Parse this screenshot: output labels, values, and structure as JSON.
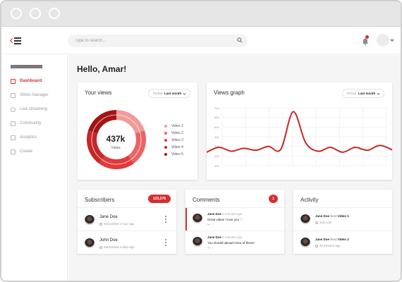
{
  "topbar": {
    "search_placeholder": "Type to search..."
  },
  "sidebar": {
    "items": [
      {
        "label": "Dashboard",
        "icon": "dashboard-icon",
        "active": true
      },
      {
        "label": "Video manager",
        "icon": "video-manager-icon"
      },
      {
        "label": "Live streaming",
        "icon": "live-streaming-icon"
      },
      {
        "label": "Community",
        "icon": "community-icon"
      },
      {
        "label": "Analytics",
        "icon": "analytics-icon"
      },
      {
        "label": "Create",
        "icon": "create-icon"
      }
    ]
  },
  "main": {
    "greeting": "Hello, Amar!"
  },
  "views_card": {
    "title": "Your views",
    "period_label": "Period",
    "period_value": "Last month",
    "total": "437k",
    "total_label": "Views",
    "legend": [
      "Video 1",
      "Video 2",
      "Video 3",
      "Video 4",
      "Video 5"
    ],
    "colors": [
      "#f29a9a",
      "#e86565",
      "#e03a3a",
      "#c62828",
      "#a31515"
    ]
  },
  "graph_card": {
    "title": "Views graph",
    "period_label": "Period",
    "period_value": "Last month"
  },
  "chart_data": {
    "type": "line",
    "yticks": [
      "700",
      "600",
      "500",
      "400",
      "300",
      "200",
      "100"
    ],
    "ylim": [
      100,
      700
    ],
    "series": [
      {
        "values": [
          240,
          290,
          250,
          280,
          260,
          300,
          270,
          660,
          340,
          250,
          290,
          240,
          290,
          260,
          310,
          265
        ]
      }
    ],
    "line_color": "#c62828"
  },
  "subscribers": {
    "title": "Subscribers",
    "count": "123,376",
    "rows": [
      {
        "name": "Jane Doe",
        "meta": "Subscribed 1 hour ago"
      },
      {
        "name": "John Doe",
        "meta": "Subscribed 4 days ago"
      }
    ]
  },
  "comments": {
    "title": "Comments",
    "count": "1",
    "rows": [
      {
        "author": "Jane Doe",
        "time": "5 minutes ago",
        "text": "Great video! I love you ♡"
      },
      {
        "author": "Jane Doe",
        "time": "5 minutes ago",
        "text": "You should upload more of these!"
      }
    ]
  },
  "activity": {
    "title": "Activity",
    "rows": [
      {
        "actor": "Jane Doe",
        "verb": "liked",
        "object": "Video 1",
        "time": "Just now"
      },
      {
        "actor": "Jane Doe",
        "verb": "liked",
        "object": "Video 2",
        "time": "40 minutes ago"
      }
    ]
  }
}
